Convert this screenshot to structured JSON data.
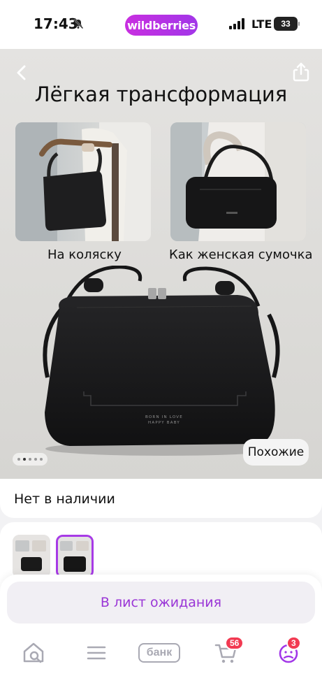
{
  "status_bar": {
    "time": "17:43",
    "brand": "wildberries",
    "network": "LTE",
    "battery": "33"
  },
  "gallery": {
    "title": "Лёгкая трансформация",
    "caption_left": "На коляску",
    "caption_right": "Как женская сумочка",
    "bag_logo_line1": "BORN IN LOVE",
    "bag_logo_line2": "HAPPY BABY",
    "similar_label": "Похожие",
    "pagination": {
      "count": 5,
      "active_index": 1
    }
  },
  "stock": {
    "text": "Нет в наличии"
  },
  "actions": {
    "waitlist_label": "В лист ожидания"
  },
  "tab_bar": {
    "bank_label": "банк",
    "cart_badge": "56",
    "profile_badge": "3"
  },
  "colors": {
    "brand_gradient_start": "#c82fe0",
    "brand_gradient_end": "#a236e8",
    "accent": "#9a36d6",
    "badge": "#f23a52",
    "icon_gray": "#a9a9b3"
  },
  "icons": [
    "bell-slash-icon",
    "signal-icon",
    "back-icon",
    "share-icon",
    "home-search-icon",
    "catalog-menu-icon",
    "cart-icon",
    "profile-icon"
  ]
}
